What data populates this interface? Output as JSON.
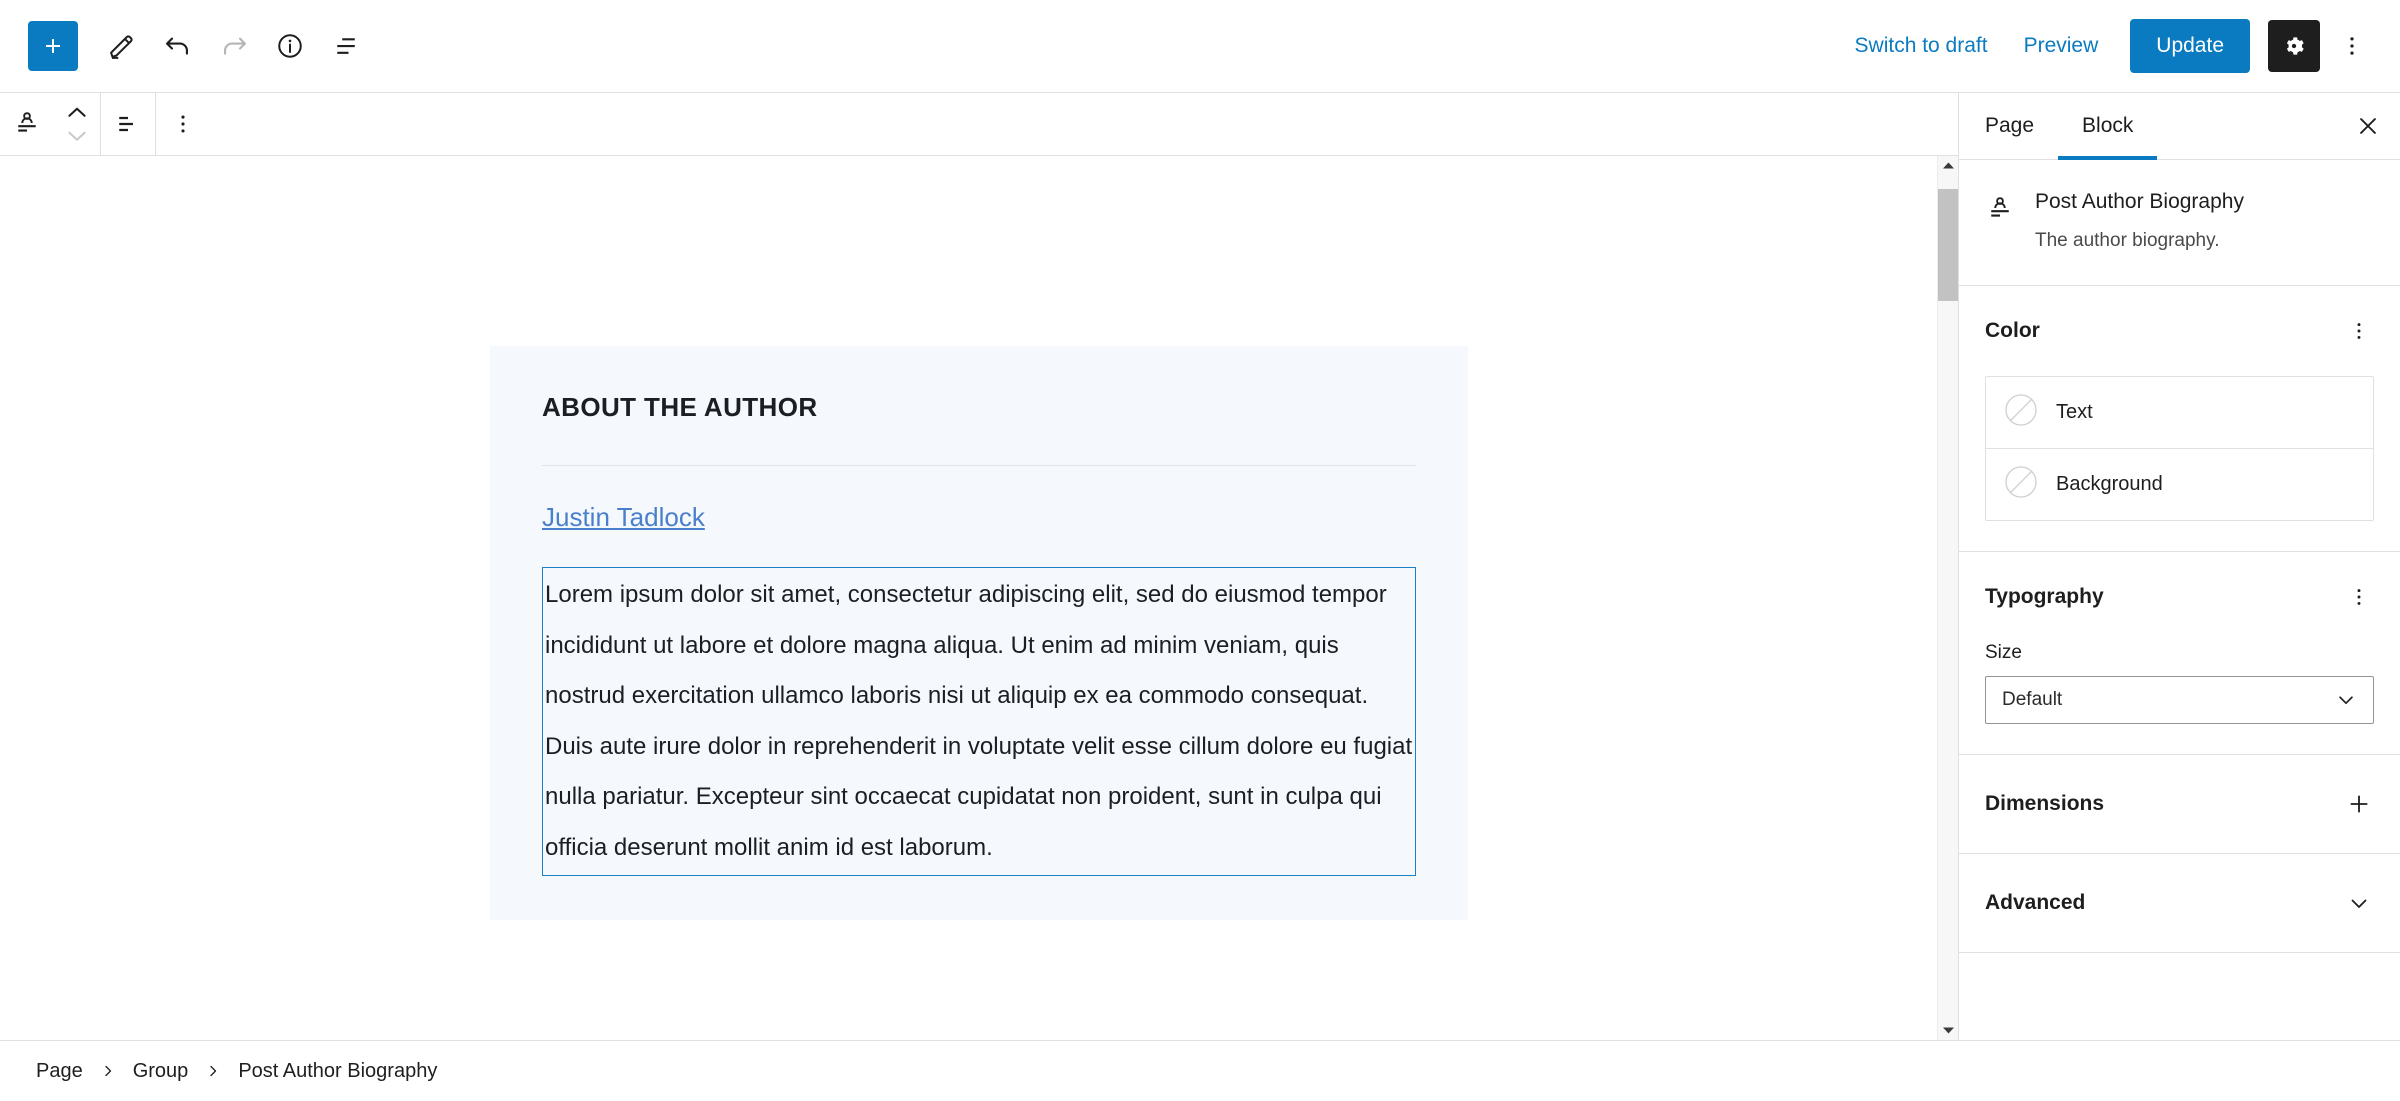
{
  "header": {
    "toolbar_left": [
      {
        "name": "block-inserter-button",
        "icon": "plus-icon",
        "label": "Toggle block inserter"
      },
      {
        "name": "tools-button",
        "icon": "pencil-icon",
        "label": "Tools"
      },
      {
        "name": "undo-button",
        "icon": "undo-icon",
        "label": "Undo"
      },
      {
        "name": "redo-button",
        "icon": "redo-icon",
        "label": "Redo"
      },
      {
        "name": "details-button",
        "icon": "info-icon",
        "label": "Details"
      },
      {
        "name": "list-view-button",
        "icon": "list-view-icon",
        "label": "List View"
      }
    ],
    "switch_to_draft_label": "Switch to draft",
    "preview_label": "Preview",
    "update_label": "Update",
    "settings_icon": "gear-icon",
    "options_icon": "kebab-vertical-icon",
    "accent_color": "#0b7bc1",
    "settings_button_bg": "#1e1e1e"
  },
  "block_toolbar": {
    "block_type_icon": "post-author-biography-icon",
    "move_up_label": "Move up",
    "move_down_label": "Move down",
    "align_icon": "align-text-icon",
    "options_icon": "kebab-vertical-icon"
  },
  "canvas": {
    "group": {
      "background_color": "#f5f8fc",
      "heading": "ABOUT THE AUTHOR",
      "author_name": "Justin Tadlock",
      "author_link_color": "#4a7fcb",
      "biography": "Lorem ipsum dolor sit amet, consectetur adipiscing elit, sed do eiusmod tempor incididunt ut labore et dolore magna aliqua. Ut enim ad minim veniam, quis nostrud exercitation ullamco laboris nisi ut aliquip ex ea commodo consequat. Duis aute irure dolor in reprehenderit in voluptate velit esse cillum dolore eu fugiat nulla pariatur. Excepteur sint occaecat cupidatat non proident, sunt in culpa qui officia deserunt mollit anim id est laborum.",
      "selected_block_border_color": "#1b82c9"
    }
  },
  "sidebar": {
    "tabs": [
      {
        "label": "Page",
        "active": false
      },
      {
        "label": "Block",
        "active": true
      }
    ],
    "close_icon": "close-icon",
    "block_card": {
      "icon": "post-author-biography-icon",
      "title": "Post Author Biography",
      "description": "The author biography."
    },
    "panels": [
      {
        "title": "Color",
        "action_icon": "kebab-vertical-icon",
        "rows": [
          {
            "label": "Text",
            "swatch": "none-swatch-icon"
          },
          {
            "label": "Background",
            "swatch": "none-swatch-icon"
          }
        ]
      },
      {
        "title": "Typography",
        "action_icon": "kebab-vertical-icon",
        "size_label": "Size",
        "size_value": "Default"
      },
      {
        "title": "Dimensions",
        "action_icon": "plus-icon"
      },
      {
        "title": "Advanced",
        "action_icon": "chevron-down-icon"
      }
    ]
  },
  "footer": {
    "breadcrumbs": [
      "Page",
      "Group",
      "Post Author Biography"
    ],
    "separator": "›"
  }
}
